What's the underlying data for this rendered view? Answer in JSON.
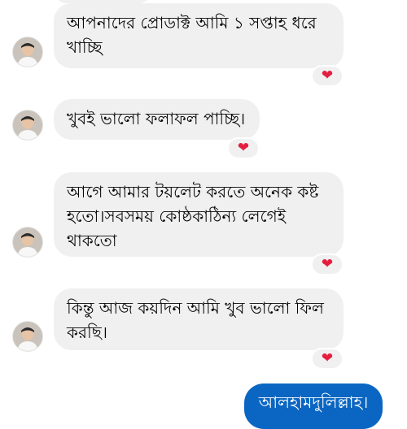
{
  "messages": [
    {
      "text_line1": "আপনাদের প্রোডাক্ট আমি ১ সপ্তাহ ধরে",
      "text_line2": "খাচ্ছি",
      "reaction": "❤"
    },
    {
      "text_line1": "খুবই ভালো ফলাফল পাচ্ছি।",
      "reaction": "❤"
    },
    {
      "text_line1": "আগে আমার টয়লেট করতে অনেক কষ্ট",
      "text_line2": "হতো।সবসময় কোষ্ঠকাঠিন্য লেগেই",
      "text_line3": "থাকতো",
      "reaction": "❤"
    },
    {
      "text_line1": "কিন্তু আজ কয়দিন আমি খুব ভালো ফিল",
      "text_line2": "করছি।",
      "reaction": "❤"
    }
  ],
  "outgoing": {
    "text": "আলহামদুলিল্লাহ।"
  },
  "colors": {
    "incoming_bubble": "#f0f0f0",
    "outgoing_bubble": "#0a66c2",
    "heart": "#e41e3f"
  },
  "icons": {
    "avatar": "user-avatar",
    "reaction": "heart-icon"
  }
}
